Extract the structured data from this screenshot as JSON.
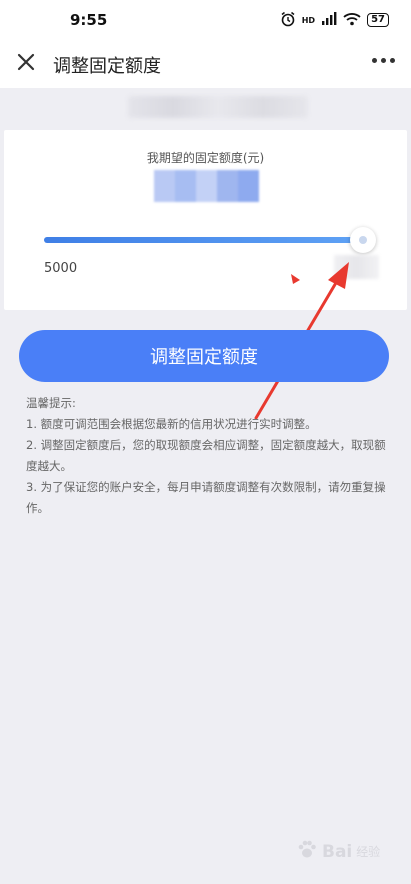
{
  "status_bar": {
    "time": "9:55",
    "network_label": "HD",
    "battery": "57"
  },
  "nav": {
    "title": "调整固定额度"
  },
  "card": {
    "label": "我期望的固定额度(元)",
    "slider_level": 1.0,
    "min_label": "5000"
  },
  "button": {
    "label": "调整固定额度"
  },
  "tips": {
    "heading": "温馨提示:",
    "items": [
      "1. 额度可调范围会根据您最新的信用状况进行实时调整。",
      "2. 调整固定额度后，您的取现额度会相应调整，固定额度越大，取现额度越大。",
      "3. 为了保证您的账户安全，每月申请额度调整有次数限制，请勿重复操作。"
    ]
  },
  "watermark": {
    "text": "Bai",
    "sub": "经验"
  },
  "colors": {
    "accent": "#4a7ff7",
    "annotation": "#e8392f"
  }
}
